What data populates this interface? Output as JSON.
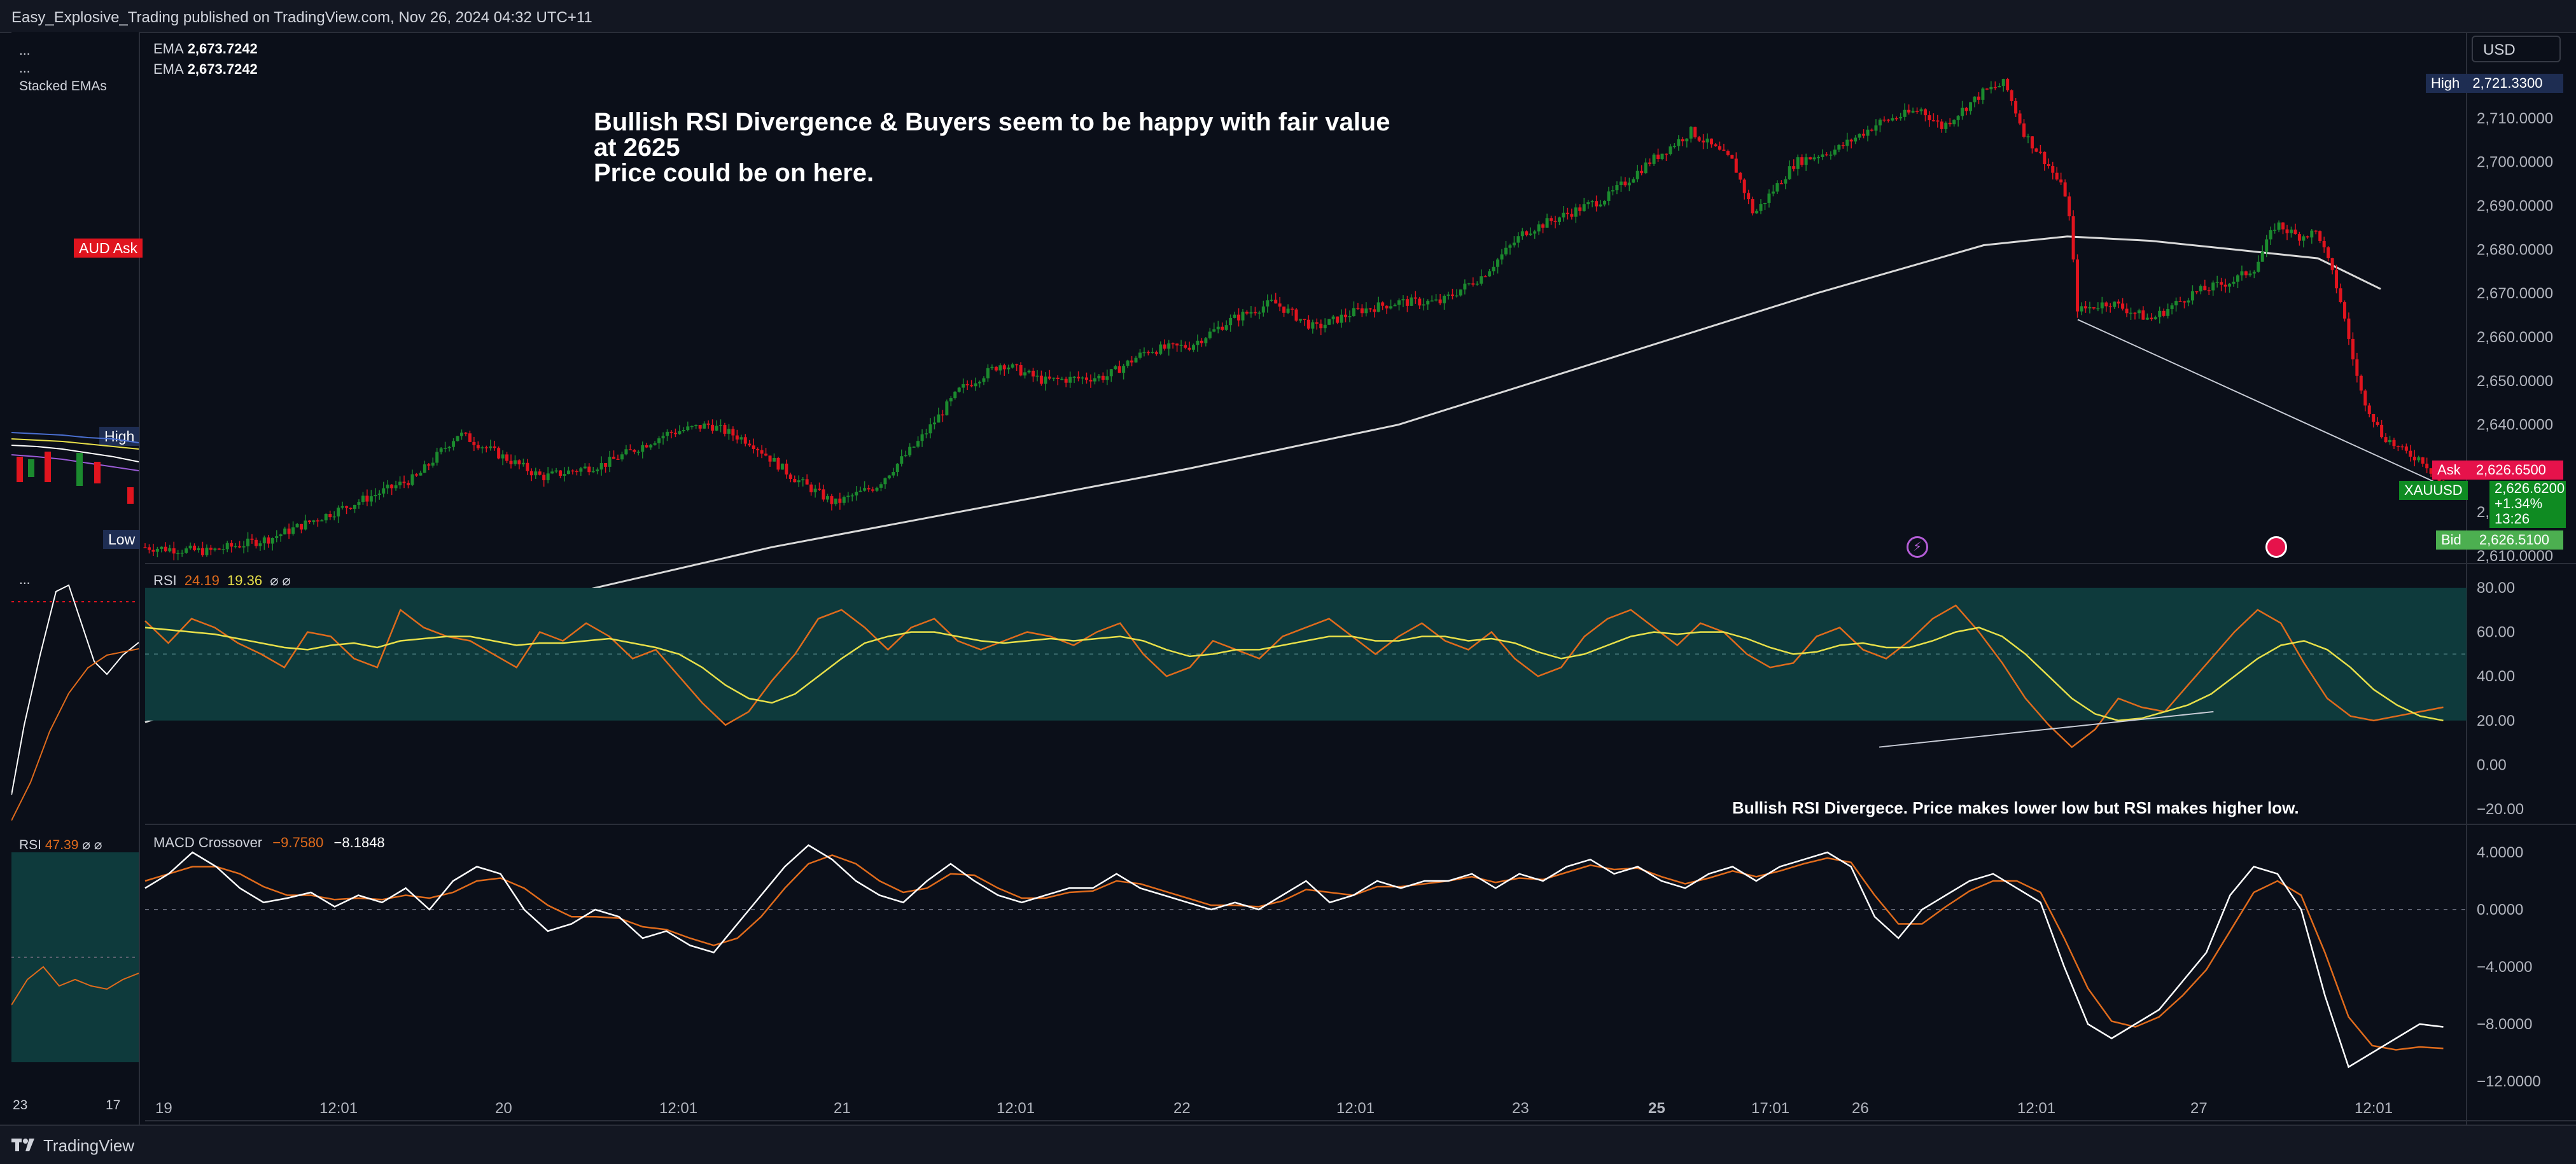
{
  "header": {
    "publisher_line": "Easy_Explosive_Trading published on TradingView.com, Nov 26, 2024 04:32 UTC+11"
  },
  "footer": {
    "brand": "TradingView"
  },
  "currency_selector": {
    "value": "USD"
  },
  "side_panel": {
    "dots1": "...",
    "dots2": "...",
    "indicator": "Stacked EMAs",
    "aud_label": "AUD",
    "ask_label": "Ask",
    "high_label": "High",
    "low_label": "Low",
    "osc_dots": "...",
    "rsi_label": "RSI",
    "rsi_value": "47.39",
    "rsi_icons": "⌀ ⌀",
    "x_ticks": [
      "23",
      "17"
    ]
  },
  "legend": {
    "ema1_label": "EMA",
    "ema1_value": "2,673.7242",
    "ema2_label": "EMA",
    "ema2_value": "2,673.7242",
    "rsi_label": "RSI",
    "rsi_value": "24.19",
    "rsi_ma_value": "19.36",
    "rsi_icons": "⌀ ⌀",
    "macd_label": "MACD Crossover",
    "macd_value": "−9.7580",
    "macd_signal_value": "−8.1848",
    "dots": "..."
  },
  "annotations": {
    "main_title": "Bullish RSI Divergence & Buyers seem to be happy with fair value at 2625\nPrice could be on here.",
    "rsi_note": "Bullish RSI Divergece. Price makes lower low but RSI makes higher low."
  },
  "price_tags": {
    "high_label": "High",
    "high_value": "2,721.3300",
    "ask_label": "Ask",
    "ask_value": "2,626.6500",
    "symbol_label": "XAUUSD",
    "last_value": "2,626.6200",
    "change_pct": "+1.34%",
    "countdown": "13:26",
    "bid_label": "Bid",
    "bid_value": "2,626.5100"
  },
  "colors": {
    "background": "#0b0f19",
    "up_candle": "#26a69a",
    "candle_green": "#1b8a2e",
    "candle_red": "#e0141e",
    "ema_line": "#d9d9d9",
    "rsi_line": "#e06b1c",
    "rsi_ma": "#e8e04a",
    "rsi_band": "#0e3a3c",
    "macd_line": "#ffffff",
    "signal_line": "#e06b1c",
    "ask": "#e6124b",
    "bid_green": "#4caf50"
  },
  "chart_data": [
    {
      "type": "candlestick",
      "title": "XAUUSD",
      "ylim": [
        2610,
        2725
      ],
      "y_ticks": [
        "2,610.0000",
        "2,620.0000",
        "2,630.0000",
        "2,640.0000",
        "2,650.0000",
        "2,660.0000",
        "2,670.0000",
        "2,680.0000",
        "2,690.0000",
        "2,700.0000",
        "2,710.0000"
      ],
      "x_ticks": [
        "19",
        "12:01",
        "20",
        "12:01",
        "21",
        "12:01",
        "22",
        "12:01",
        "23",
        "25",
        "17:01",
        "26",
        "12:01",
        "27",
        "12:01"
      ],
      "price_path": [
        [
          0,
          2612
        ],
        [
          3,
          2611
        ],
        [
          6,
          2614
        ],
        [
          10,
          2622
        ],
        [
          13,
          2628
        ],
        [
          15,
          2638
        ],
        [
          17,
          2633
        ],
        [
          19,
          2628
        ],
        [
          22,
          2631
        ],
        [
          25,
          2638
        ],
        [
          27,
          2640
        ],
        [
          29,
          2636
        ],
        [
          31,
          2628
        ],
        [
          33,
          2622
        ],
        [
          35,
          2626
        ],
        [
          37,
          2636
        ],
        [
          39,
          2648
        ],
        [
          41,
          2654
        ],
        [
          43,
          2650
        ],
        [
          46,
          2651
        ],
        [
          48,
          2657
        ],
        [
          50,
          2658
        ],
        [
          52,
          2664
        ],
        [
          54,
          2668
        ],
        [
          56,
          2662
        ],
        [
          58,
          2666
        ],
        [
          60,
          2668
        ],
        [
          62,
          2668
        ],
        [
          64,
          2674
        ],
        [
          66,
          2684
        ],
        [
          68,
          2688
        ],
        [
          70,
          2692
        ],
        [
          72,
          2700
        ],
        [
          74,
          2707
        ],
        [
          76,
          2700
        ],
        [
          77,
          2688
        ],
        [
          79,
          2700
        ],
        [
          81,
          2703
        ],
        [
          83,
          2709
        ],
        [
          85,
          2712
        ],
        [
          86,
          2708
        ],
        [
          88,
          2716
        ],
        [
          89,
          2718
        ],
        [
          90,
          2706
        ],
        [
          91,
          2700
        ],
        [
          92,
          2692
        ],
        [
          92.5,
          2666
        ],
        [
          94,
          2668
        ],
        [
          96,
          2664
        ],
        [
          98,
          2670
        ],
        [
          100,
          2673
        ],
        [
          101,
          2676
        ],
        [
          102,
          2686
        ],
        [
          103,
          2683
        ],
        [
          104,
          2684
        ],
        [
          105,
          2670
        ],
        [
          106,
          2648
        ],
        [
          107,
          2638
        ],
        [
          108,
          2634
        ],
        [
          109,
          2632
        ],
        [
          110,
          2626
        ]
      ],
      "ema_path": [
        [
          0,
          2572
        ],
        [
          10,
          2588
        ],
        [
          20,
          2601
        ],
        [
          30,
          2612
        ],
        [
          40,
          2621
        ],
        [
          50,
          2630
        ],
        [
          60,
          2640
        ],
        [
          70,
          2655
        ],
        [
          80,
          2670
        ],
        [
          88,
          2681
        ],
        [
          92,
          2683
        ],
        [
          96,
          2682
        ],
        [
          100,
          2680
        ],
        [
          104,
          2678
        ],
        [
          107,
          2671
        ]
      ],
      "divergence_line": [
        [
          92.5,
          2664
        ],
        [
          110,
          2626
        ]
      ]
    },
    {
      "type": "line",
      "title": "RSI",
      "ylim": [
        -20,
        80
      ],
      "y_ticks": [
        "80.00",
        "60.00",
        "40.00",
        "20.00",
        "0.00",
        "−20.00"
      ],
      "band": [
        20,
        80
      ],
      "series": [
        {
          "name": "RSI",
          "values": [
            65,
            55,
            66,
            62,
            55,
            50,
            44,
            60,
            58,
            48,
            44,
            70,
            62,
            58,
            56,
            50,
            44,
            60,
            56,
            64,
            58,
            48,
            52,
            40,
            28,
            18,
            24,
            38,
            50,
            66,
            70,
            62,
            52,
            62,
            66,
            56,
            52,
            56,
            60,
            58,
            54,
            60,
            64,
            50,
            40,
            44,
            56,
            52,
            48,
            58,
            62,
            66,
            58,
            50,
            58,
            64,
            56,
            52,
            60,
            48,
            40,
            44,
            58,
            66,
            70,
            62,
            54,
            64,
            60,
            50,
            44,
            46,
            58,
            62,
            52,
            48,
            56,
            66,
            72,
            60,
            46,
            30,
            18,
            8,
            16,
            30,
            26,
            24,
            36,
            48,
            60,
            70,
            64,
            46,
            30,
            22,
            20,
            22,
            24,
            26
          ]
        },
        {
          "name": "RSI-based MA",
          "values": [
            62,
            61,
            60,
            59,
            57,
            55,
            53,
            52,
            54,
            55,
            53,
            56,
            57,
            58,
            58,
            56,
            54,
            55,
            55,
            56,
            57,
            55,
            53,
            50,
            44,
            36,
            30,
            28,
            32,
            40,
            48,
            55,
            58,
            60,
            60,
            58,
            56,
            55,
            56,
            57,
            56,
            57,
            58,
            56,
            52,
            49,
            50,
            52,
            52,
            54,
            56,
            58,
            58,
            56,
            56,
            58,
            58,
            56,
            57,
            55,
            51,
            48,
            50,
            54,
            58,
            60,
            59,
            60,
            60,
            57,
            53,
            50,
            51,
            54,
            55,
            53,
            53,
            56,
            60,
            62,
            58,
            50,
            40,
            30,
            23,
            20,
            21,
            24,
            27,
            32,
            40,
            48,
            54,
            56,
            52,
            44,
            34,
            27,
            22,
            20
          ]
        }
      ],
      "divergence_line": [
        [
          83,
          8
        ],
        [
          99,
          24
        ]
      ]
    },
    {
      "type": "line",
      "title": "MACD Crossover",
      "ylim": [
        -12,
        4
      ],
      "y_ticks": [
        "4.0000",
        "0.0000",
        "−4.0000",
        "−8.0000",
        "−12.0000"
      ],
      "series": [
        {
          "name": "MACD",
          "values": [
            1.5,
            2.5,
            4,
            3,
            1.5,
            0.5,
            0.8,
            1.2,
            0.2,
            1,
            0.5,
            1.5,
            0,
            2,
            3,
            2.5,
            0,
            -1.5,
            -1,
            0,
            -0.5,
            -2,
            -1.5,
            -2.5,
            -3,
            -1,
            1,
            3,
            4.5,
            3.5,
            2,
            1,
            0.5,
            2,
            3.2,
            2,
            1,
            0.5,
            1,
            1.5,
            1.5,
            2.5,
            1.5,
            1,
            0.5,
            0,
            0.5,
            0,
            1,
            2,
            0.5,
            1,
            2,
            1.5,
            2,
            2,
            2.5,
            1.5,
            2.5,
            2,
            3,
            3.5,
            2.5,
            3,
            2,
            1.5,
            2.5,
            3,
            2,
            3,
            3.5,
            4,
            3,
            -0.5,
            -2,
            0,
            1,
            2,
            2.5,
            1.5,
            0.5,
            -4,
            -8,
            -9,
            -8,
            -7,
            -5,
            -3,
            1,
            3,
            2.5,
            0,
            -6,
            -11,
            -10,
            -9,
            -8,
            -8.2
          ]
        },
        {
          "name": "Signal",
          "values": [
            2,
            2.5,
            3,
            3,
            2.5,
            1.6,
            1,
            1,
            0.7,
            0.8,
            0.7,
            1,
            0.8,
            1.2,
            2,
            2.2,
            1.5,
            0.3,
            -0.5,
            -0.5,
            -0.6,
            -1.2,
            -1.4,
            -2,
            -2.5,
            -2,
            -0.5,
            1.5,
            3.2,
            3.8,
            3.2,
            2,
            1.2,
            1.5,
            2.5,
            2.4,
            1.5,
            0.8,
            0.8,
            1.2,
            1.3,
            2,
            1.8,
            1.3,
            0.8,
            0.3,
            0.3,
            0.2,
            0.6,
            1.4,
            1.2,
            1,
            1.6,
            1.6,
            1.8,
            2,
            2.3,
            1.9,
            2.2,
            2.1,
            2.6,
            3.1,
            2.8,
            2.9,
            2.3,
            1.8,
            2.2,
            2.7,
            2.3,
            2.7,
            3.2,
            3.6,
            3.3,
            1,
            -1,
            -1,
            0.2,
            1.3,
            2,
            2,
            1.2,
            -2,
            -5.5,
            -7.8,
            -8.2,
            -7.5,
            -6,
            -4.2,
            -1.5,
            1.2,
            2,
            1,
            -3,
            -7.5,
            -9.5,
            -9.8,
            -9.6,
            -9.7
          ]
        }
      ]
    }
  ]
}
